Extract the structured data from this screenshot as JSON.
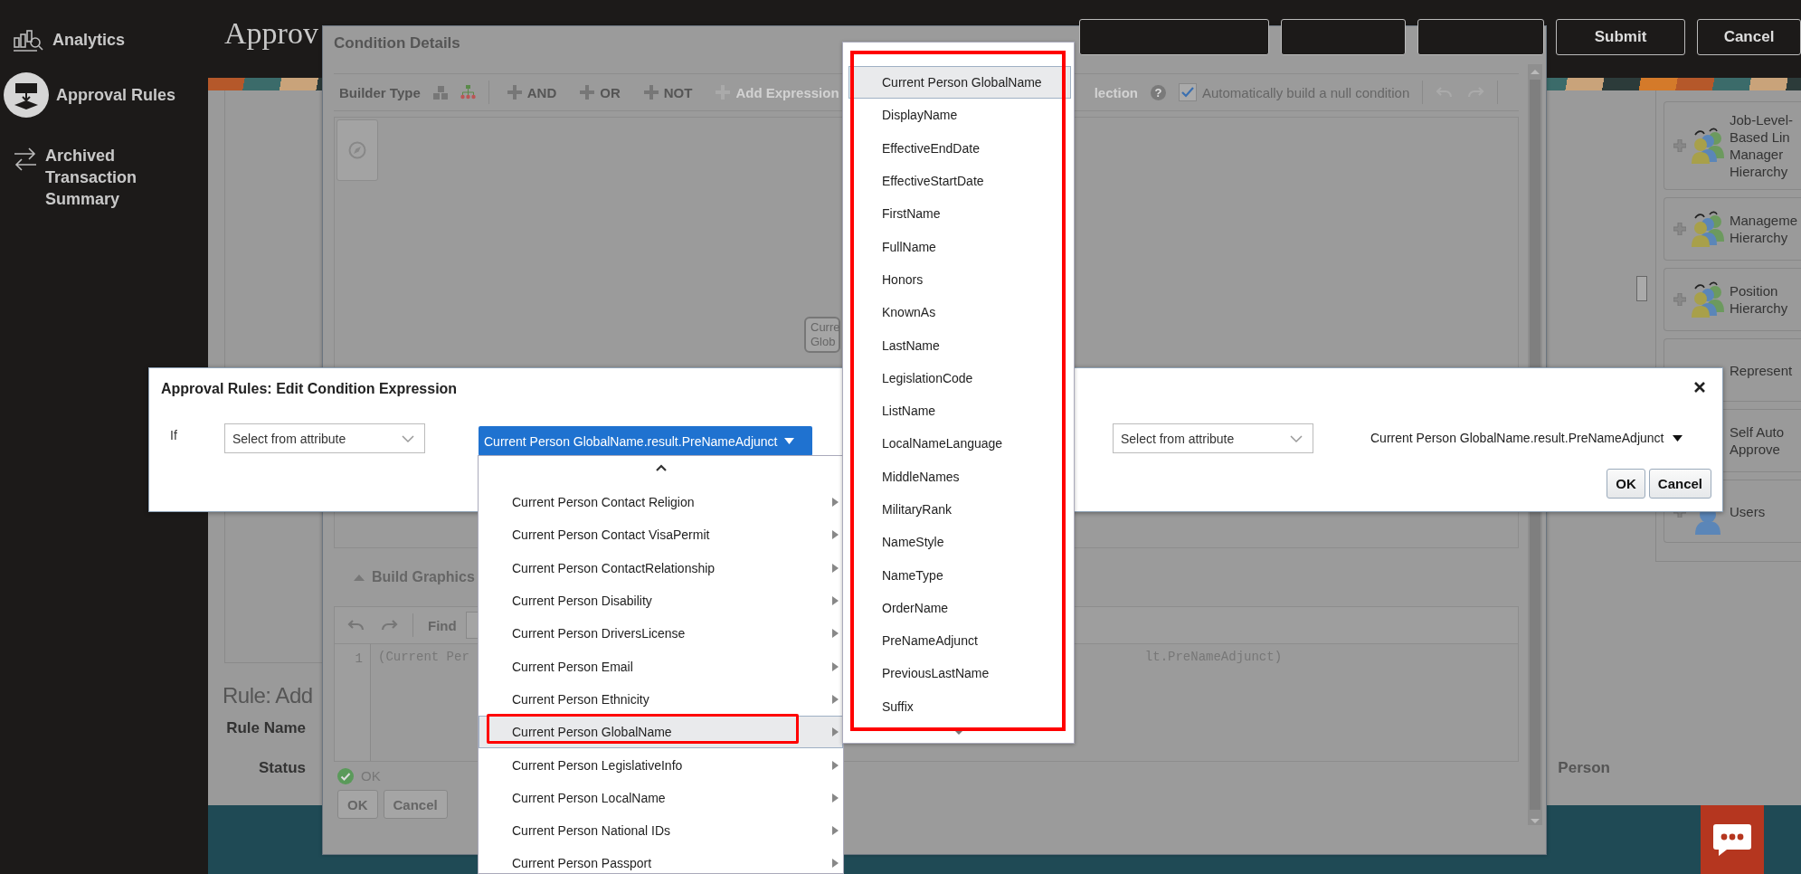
{
  "sidebar": {
    "items": [
      {
        "label": "Analytics",
        "selected": false
      },
      {
        "label": "Approval Rules",
        "selected": true
      },
      {
        "label": "Archived Transaction Summary",
        "selected": false
      }
    ]
  },
  "header": {
    "title": "Approv",
    "buttons": [
      "Submit",
      "Cancel"
    ]
  },
  "rule_form": {
    "heading": "Rule: Add",
    "fields": [
      {
        "label": "Rule Name"
      },
      {
        "label": "Status"
      }
    ],
    "person_label": "Person"
  },
  "right_panel": {
    "cards": [
      {
        "lines": [
          "Job-Level-",
          "Based Lin",
          "Manager",
          "Hierarchy"
        ],
        "kind": "group"
      },
      {
        "lines": [
          "Manageme",
          "Hierarchy"
        ],
        "kind": "group"
      },
      {
        "lines": [
          "Position",
          "Hierarchy"
        ],
        "kind": "group"
      },
      {
        "lines": [
          "Represent"
        ],
        "kind": "plain"
      },
      {
        "lines": [
          "Self Auto",
          "Approve"
        ],
        "kind": "plain"
      },
      {
        "lines": [
          "Users"
        ],
        "kind": "person"
      }
    ]
  },
  "condition_details": {
    "title": "Condition Details",
    "toolbar": {
      "builder_type_label": "Builder Type",
      "operators": [
        {
          "label": "AND",
          "disabled": false
        },
        {
          "label": "OR",
          "disabled": false
        },
        {
          "label": "NOT",
          "disabled": false
        },
        {
          "label": "Add Expression",
          "disabled": true
        }
      ],
      "selection_label": "lection",
      "help": "?",
      "auto_null": {
        "label": "Automatically build a null condition",
        "checked": true
      }
    },
    "node_lines": [
      "Curre",
      "Glob"
    ],
    "build_graphics": {
      "label": "Build Graphics",
      "expanded": true
    },
    "find_label": "Find",
    "code_line": {
      "number": "1",
      "start": "(Current Per",
      "end": "lt.PreNameAdjunct)"
    },
    "status": "OK",
    "buttons": [
      "OK",
      "Cancel"
    ]
  },
  "edit_condition": {
    "title": "Approval Rules: Edit Condition Expression",
    "if_label": "If",
    "left_attribute": {
      "placeholder": "Select from attribute"
    },
    "operator_value": "Current Person GlobalName.result.PreNameAdjunct",
    "right_attribute": {
      "placeholder": "Select from attribute"
    },
    "right_value": "Current Person GlobalName.result.PreNameAdjunct",
    "buttons": [
      "OK",
      "Cancel"
    ]
  },
  "attribute_menu": {
    "items": [
      {
        "label": "Current Person Contact Religion",
        "selected": false
      },
      {
        "label": "Current Person Contact VisaPermit",
        "selected": false
      },
      {
        "label": "Current Person ContactRelationship",
        "selected": false
      },
      {
        "label": "Current Person Disability",
        "selected": false
      },
      {
        "label": "Current Person DriversLicense",
        "selected": false
      },
      {
        "label": "Current Person Email",
        "selected": false
      },
      {
        "label": "Current Person Ethnicity",
        "selected": false
      },
      {
        "label": "Current Person GlobalName",
        "selected": true
      },
      {
        "label": "Current Person LegislativeInfo",
        "selected": false
      },
      {
        "label": "Current Person LocalName",
        "selected": false
      },
      {
        "label": "Current Person National IDs",
        "selected": false
      },
      {
        "label": "Current Person Passport",
        "selected": false
      }
    ]
  },
  "submenu": {
    "items": [
      {
        "label": "Current Person GlobalName",
        "selected": true
      },
      {
        "label": "DisplayName",
        "selected": false
      },
      {
        "label": "EffectiveEndDate",
        "selected": false
      },
      {
        "label": "EffectiveStartDate",
        "selected": false
      },
      {
        "label": "FirstName",
        "selected": false
      },
      {
        "label": "FullName",
        "selected": false
      },
      {
        "label": "Honors",
        "selected": false
      },
      {
        "label": "KnownAs",
        "selected": false
      },
      {
        "label": "LastName",
        "selected": false
      },
      {
        "label": "LegislationCode",
        "selected": false
      },
      {
        "label": "ListName",
        "selected": false
      },
      {
        "label": "LocalNameLanguage",
        "selected": false
      },
      {
        "label": "MiddleNames",
        "selected": false
      },
      {
        "label": "MilitaryRank",
        "selected": false
      },
      {
        "label": "NameStyle",
        "selected": false
      },
      {
        "label": "NameType",
        "selected": false
      },
      {
        "label": "OrderName",
        "selected": false
      },
      {
        "label": "PreNameAdjunct",
        "selected": false
      },
      {
        "label": "PreviousLastName",
        "selected": false
      },
      {
        "label": "Suffix",
        "selected": false
      }
    ]
  }
}
